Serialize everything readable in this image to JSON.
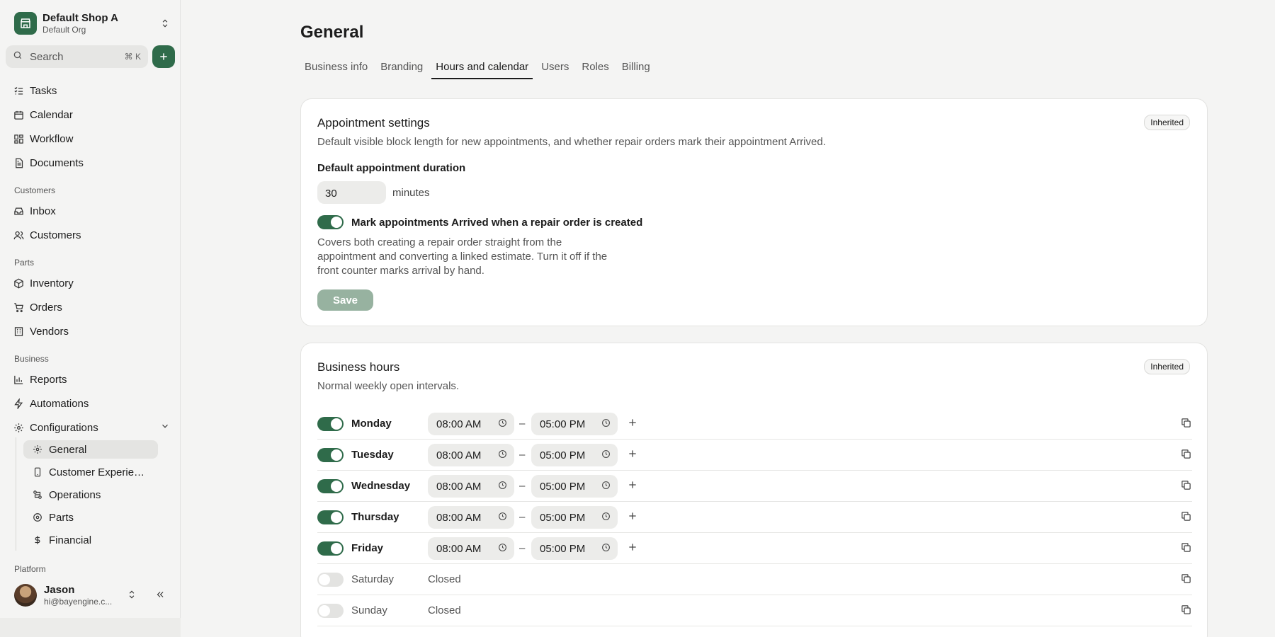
{
  "org": {
    "name": "Default Shop A",
    "sub": "Default Org"
  },
  "search": {
    "placeholder": "Search",
    "shortcut": "⌘ K"
  },
  "nav": {
    "main": [
      "Tasks",
      "Calendar",
      "Workflow",
      "Documents"
    ],
    "customers_section": "Customers",
    "customers": [
      "Inbox",
      "Customers"
    ],
    "parts_section": "Parts",
    "parts": [
      "Inventory",
      "Orders",
      "Vendors"
    ],
    "business_section": "Business",
    "business": [
      "Reports",
      "Automations",
      "Configurations"
    ],
    "config_sub": [
      "General",
      "Customer Experien...",
      "Operations",
      "Parts",
      "Financial"
    ],
    "platform_section": "Platform"
  },
  "user": {
    "name": "Jason",
    "email": "hi@bayengine.c..."
  },
  "page": {
    "title": "General",
    "tabs": [
      "Business info",
      "Branding",
      "Hours and calendar",
      "Users",
      "Roles",
      "Billing"
    ],
    "active_tab": "Hours and calendar"
  },
  "appointment": {
    "title": "Appointment settings",
    "badge": "Inherited",
    "description": "Default visible block length for new appointments, and whether repair orders mark their appointment Arrived.",
    "duration_label": "Default appointment duration",
    "duration_value": "30",
    "duration_unit": "minutes",
    "arrived_label": "Mark appointments Arrived when a repair order is created",
    "arrived_enabled": true,
    "arrived_help": "Covers both creating a repair order straight from the appointment and converting a linked estimate. Turn it off if the front counter marks arrival by hand.",
    "save_label": "Save"
  },
  "hours": {
    "title": "Business hours",
    "badge": "Inherited",
    "description": "Normal weekly open intervals.",
    "separator": "–",
    "days": [
      {
        "name": "Monday",
        "open": true,
        "start": "08:00 AM",
        "end": "05:00 PM"
      },
      {
        "name": "Tuesday",
        "open": true,
        "start": "08:00 AM",
        "end": "05:00 PM"
      },
      {
        "name": "Wednesday",
        "open": true,
        "start": "08:00 AM",
        "end": "05:00 PM"
      },
      {
        "name": "Thursday",
        "open": true,
        "start": "08:00 AM",
        "end": "05:00 PM"
      },
      {
        "name": "Friday",
        "open": true,
        "start": "08:00 AM",
        "end": "05:00 PM"
      },
      {
        "name": "Saturday",
        "open": false,
        "closed_label": "Closed"
      },
      {
        "name": "Sunday",
        "open": false,
        "closed_label": "Closed"
      }
    ]
  },
  "colors": {
    "accent": "#2f6b4a",
    "save_disabled": "#97b2a0",
    "background": "#f4f4f3"
  }
}
